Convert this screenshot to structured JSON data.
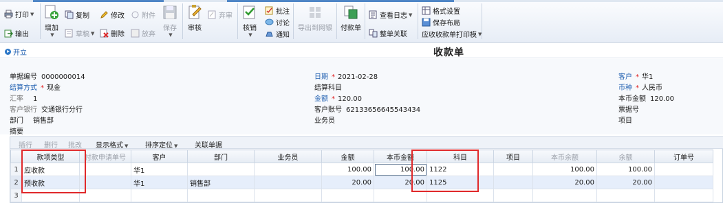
{
  "toolbar": {
    "print": "打印",
    "export": "输出",
    "add": "增加",
    "copy": "复制",
    "edit": "修改",
    "attach": "附件",
    "draft": "草稿",
    "delete": "删除",
    "abandon": "放弃",
    "save": "保存",
    "audit": "审核",
    "unaudit": "弃审",
    "writeoff": "核销",
    "annotate": "批注",
    "discuss": "讨论",
    "notify": "通知",
    "export_net": "导出到网银",
    "payment": "付款单",
    "view_log": "查看日志",
    "doc_link": "整单关联",
    "format_settings": "格式设置",
    "save_layout": "保存布局",
    "print_template": "应收收款单打印模"
  },
  "titlebar": {
    "open": "开立",
    "title": "收款单"
  },
  "form": {
    "doc_no_label": "单据编号",
    "doc_no": "0000000014",
    "settle_label": "结算方式",
    "settle": "现金",
    "rate_label": "汇率",
    "rate": "1",
    "bank_label": "客户银行",
    "bank": "交通银行分行",
    "dept_label": "部门",
    "dept": "销售部",
    "memo_label": "摘要",
    "date_label": "日期",
    "date": "2021-02-28",
    "subject_label": "结算科目",
    "amount_label": "金额",
    "amount": "120.00",
    "account_label": "客户账号",
    "account": "62133656645543434",
    "salesman_label": "业务员",
    "customer_label": "客户",
    "customer": "华1",
    "currency_label": "币种",
    "currency": "人民币",
    "local_amount_label": "本币金额",
    "local_amount": "120.00",
    "bill_no_label": "票据号",
    "project_label": "项目"
  },
  "grid_toolbar": {
    "insert": "插行",
    "delete_row": "删行",
    "batch": "批改",
    "display": "显示格式",
    "sort": "排序定位",
    "link": "关联单据"
  },
  "grid": {
    "columns": [
      "款项类型",
      "付款申请单号",
      "客户",
      "部门",
      "业务员",
      "金额",
      "本币金额",
      "科目",
      "项目",
      "本币余额",
      "余额",
      "订单号"
    ],
    "rows": [
      {
        "no": "1",
        "type": "应收款",
        "apply_no": "",
        "customer": "华1",
        "dept": "",
        "salesman": "",
        "amount": "100.00",
        "local_amount": "100.00",
        "subject": "1122",
        "project": "",
        "local_balance": "100.00",
        "balance": "100.00",
        "order_no": ""
      },
      {
        "no": "2",
        "type": "预收款",
        "apply_no": "",
        "customer": "华1",
        "dept": "销售部",
        "salesman": "",
        "amount": "20.00",
        "local_amount": "20.00",
        "subject": "1125",
        "project": "",
        "local_balance": "20.00",
        "balance": "20.00",
        "order_no": ""
      },
      {
        "no": "3",
        "type": "",
        "apply_no": "",
        "customer": "",
        "dept": "",
        "salesman": "",
        "amount": "",
        "local_amount": "",
        "subject": "",
        "project": "",
        "local_balance": "",
        "balance": "",
        "order_no": ""
      }
    ]
  },
  "colors": {
    "accent": "#1f5fb0",
    "highlight_box": "#e0282a",
    "required": "#e02020"
  }
}
